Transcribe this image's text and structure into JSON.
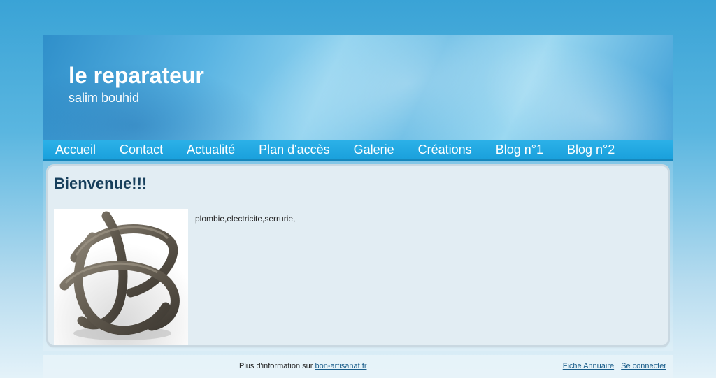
{
  "header": {
    "title": "le reparateur",
    "subtitle": "salim bouhid"
  },
  "nav": {
    "items": [
      {
        "label": "Accueil"
      },
      {
        "label": "Contact"
      },
      {
        "label": "Actualité"
      },
      {
        "label": "Plan d'accès"
      },
      {
        "label": "Galerie"
      },
      {
        "label": "Créations"
      },
      {
        "label": "Blog n°1"
      },
      {
        "label": "Blog n°2"
      }
    ]
  },
  "main": {
    "heading": "Bienvenue!!!",
    "description": "plombie,electricite,serrurie,"
  },
  "footer": {
    "info_text": "Plus d'information sur",
    "info_link": "bon-artisanat.fr",
    "fiche_link": "Fiche Annuaire",
    "login_link": "Se connecter"
  },
  "colors": {
    "nav_bg": "#1aa0dc",
    "heading": "#173f5c",
    "link": "#1a5d8a"
  }
}
